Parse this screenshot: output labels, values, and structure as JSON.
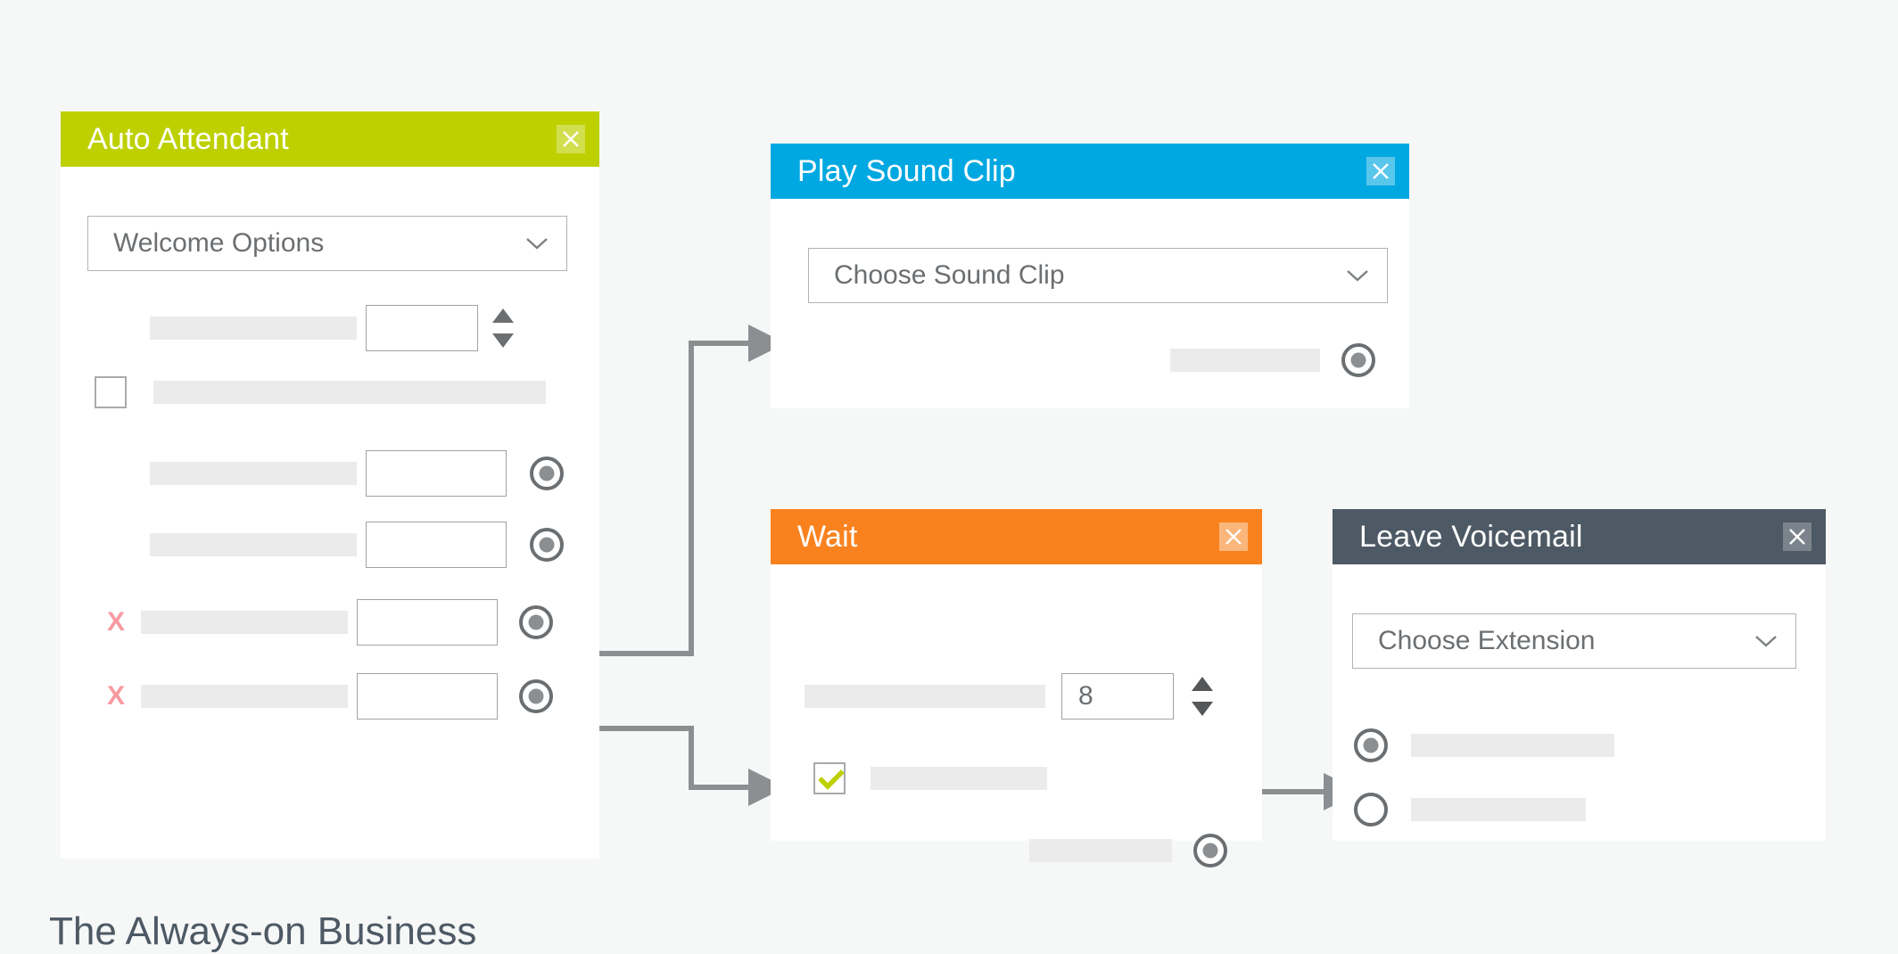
{
  "page": {
    "background_color": "#f6f7f7",
    "bottom_caption": "The Always-on Business"
  },
  "colors": {
    "green": "#bed000",
    "blue": "#00a8e1",
    "orange": "#f9821e",
    "slate": "#4d5964",
    "connector": "#8c8f91",
    "placeholder_bar": "#ebebeb",
    "x_mark": "#f79aa0",
    "check_mark": "#bed000",
    "card_white": "#ffffff",
    "border_gray": "#b0b3b5",
    "text_gray": "#6b6f72"
  },
  "cards": {
    "auto_attendant": {
      "title": "Auto Attendant",
      "accent": "#bed000",
      "close_icon": "close-icon",
      "dropdown": {
        "value": "Welcome Options",
        "icon": "chevron-down-icon"
      },
      "rows": [
        {
          "type": "stepper",
          "label": "",
          "value": "",
          "has_x": false,
          "has_radio": false,
          "has_spinner": true
        },
        {
          "type": "checkbox",
          "label": "",
          "value": "",
          "has_x": false,
          "has_radio": false,
          "checked": false
        },
        {
          "type": "input",
          "label": "",
          "value": "",
          "has_x": false,
          "has_radio": true
        },
        {
          "type": "input",
          "label": "",
          "value": "",
          "has_x": false,
          "has_radio": true
        },
        {
          "type": "input",
          "label": "",
          "value": "",
          "has_x": true,
          "has_radio": true,
          "x_label": "X"
        },
        {
          "type": "input",
          "label": "",
          "value": "",
          "has_x": true,
          "has_radio": true,
          "x_label": "X"
        }
      ]
    },
    "play_sound_clip": {
      "title": "Play Sound Clip",
      "accent": "#00a8e1",
      "close_icon": "close-icon",
      "dropdown": {
        "value": "Choose Sound Clip",
        "icon": "chevron-down-icon"
      },
      "footer": {
        "label": "",
        "has_radio": true
      }
    },
    "wait": {
      "title": "Wait",
      "accent": "#f9821e",
      "close_icon": "close-icon",
      "duration_row": {
        "label": "",
        "value": "8",
        "has_spinner": true
      },
      "checkbox_row": {
        "label": "",
        "checked": true,
        "check_icon": "check-icon"
      },
      "footer": {
        "label": "",
        "has_radio": true
      }
    },
    "leave_voicemail": {
      "title": "Leave Voicemail",
      "accent": "#4d5964",
      "close_icon": "close-icon",
      "dropdown": {
        "value": "Choose Extension",
        "icon": "chevron-down-icon"
      },
      "options": [
        {
          "label": "",
          "selected": true
        },
        {
          "label": "",
          "selected": false
        }
      ]
    }
  },
  "connectors": [
    {
      "from": "auto-attendant-row-5-radio",
      "to": "play-sound-clip-input",
      "arrow": "arrow-right"
    },
    {
      "from": "auto-attendant-row-6-radio",
      "to": "wait-input",
      "arrow": "arrow-right"
    },
    {
      "from": "wait-output-radio",
      "to": "leave-voicemail-option-2",
      "arrow": "arrow-right"
    }
  ]
}
